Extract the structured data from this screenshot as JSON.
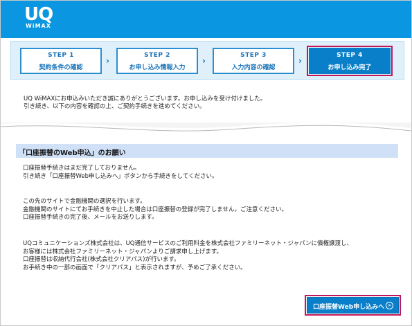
{
  "header": {
    "logo_main": "UQ",
    "logo_sub": "WiMAX",
    "bg_color": "#0a96e0"
  },
  "steps": [
    {
      "num": "STEP 1",
      "label": "契約条件の確認"
    },
    {
      "num": "STEP 2",
      "label": "お申し込み情報入力"
    },
    {
      "num": "STEP 3",
      "label": "入力内容の確認"
    },
    {
      "num": "STEP 4",
      "label": "お申し込み完了",
      "active": true
    }
  ],
  "arrow_glyph": "›",
  "intro": {
    "line1": "UQ WiMAXにお申込みいただき誠にありがとうございます。お申し込みを受け付けました。",
    "line2": "引き続き、以下の内容を確認の上、ご契約手続きを進めてください。"
  },
  "section": {
    "title": "「口座振替のWeb申込」のお願い",
    "p1": [
      "口座振替手続きはまだ完了しておりません。",
      "引き続き「口座振替Web申し込みへ」ボタンから手続きをしてください。"
    ],
    "p2": [
      "この先のサイトで金融機関の選択を行います。",
      "金融機関のサイトにてお手続きを中止した場合は口座振替の登録が完了しません。ご注意ください。",
      "口座振替手続きの完了後、メールをお送りします。"
    ],
    "p3": [
      "UQコミュニケーションズ株式会社は、UQ通信サービスのご利用料金を株式会社ファミリーネット・ジャパンに債権譲渡し、",
      "お客様には株式会社ファミリーネット・ジャパンよりご請求申し上げます。",
      "口座振替は収納代行会社(株式会社クリアパス)が行います。",
      "お手続き中の一部の画面で「クリアパス」と表示されますが、予めご了承ください。"
    ]
  },
  "button": {
    "label": "口座振替Web申し込みへ",
    "icon": "arrow-circle-icon"
  }
}
